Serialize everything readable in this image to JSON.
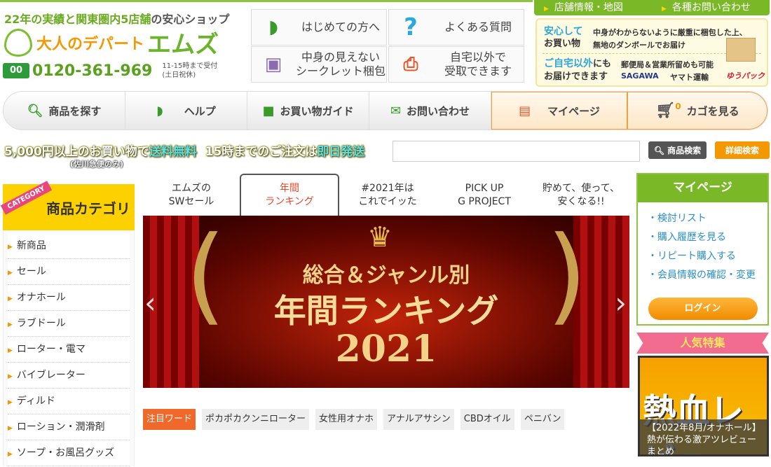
{
  "header": {
    "tagline_a": "22年の実績と関東圏内5店舗",
    "tagline_b": "の安心ショップ",
    "logo_text": "大人のデパート",
    "logo_brand": "エムズ",
    "freedial_icon": "free-dial-icon",
    "phone": "0120-361-969",
    "hours_1": "11-15時まで受付",
    "hours_2": "(土日祝休)"
  },
  "features": [
    {
      "label": "はじめての方へ",
      "icon": "beginner-mark-icon"
    },
    {
      "label": "よくある質問",
      "icon": "question-icon"
    },
    {
      "label": "中身の見えない\nシークレット梱包",
      "icon": "box-icon"
    },
    {
      "label": "自宅以外で\n受取できます",
      "icon": "receive-icon"
    }
  ],
  "topnav": [
    "店舗情報・地図",
    "各種お問い合わせ"
  ],
  "infobox": {
    "a_title1": "安心して",
    "a_title2": "お買い物",
    "a_text1": "中身がわからないように厳重に梱包した上、",
    "a_text2": "無地のダンボールでお届け",
    "b_title1": "ご自宅以外",
    "b_title1b": "にも",
    "b_title2": "お届けできます",
    "b_text": "郵便局＆営業所留めも可能",
    "carriers": [
      "SAGAWA",
      "ヤマト運輸",
      "ゆうパック"
    ]
  },
  "mainnav": [
    {
      "label": "商品を探す",
      "icon": "search-icon"
    },
    {
      "label": "ヘルプ",
      "icon": "beginner-mark-icon"
    },
    {
      "label": "お買い物ガイド",
      "icon": "shopping-bag-icon"
    },
    {
      "label": "お問い合わせ",
      "icon": "mail-icon"
    },
    {
      "label": "マイページ",
      "icon": "profile-card-icon"
    },
    {
      "label": "カゴを見る",
      "icon": "cart-icon",
      "count": "0"
    }
  ],
  "promo": {
    "p1": "5,000円以上のお買い物で",
    "p2": "送料無料",
    "p3": "15時までのご注文は",
    "p4": "即日発送",
    "note": "(佐川急便のみ)"
  },
  "search": {
    "value": "",
    "button": "商品検索",
    "advanced": "詳細検索"
  },
  "sidebar": {
    "ribbon": "CATEGORY",
    "title": "商品カテゴリ",
    "items": [
      "新商品",
      "セール",
      "オナホール",
      "ラブドール",
      "ローター・電マ",
      "バイブレーター",
      "ディルド",
      "ローション・潤滑剤",
      "ソープ・お風呂グッズ"
    ]
  },
  "tabs": [
    {
      "label": "エムズの\nSWセール"
    },
    {
      "label": "年間\nランキング",
      "active": true
    },
    {
      "label": "#2021年は\nこれでイッた"
    },
    {
      "label": "PICK UP\nG PROJECT"
    },
    {
      "label": "貯めて、使って、\n安くなる!!"
    }
  ],
  "banner": {
    "line1": "総合＆ジャンル別",
    "line2": "年間ランキング",
    "line3": "2021"
  },
  "tags": {
    "heading": "注目ワード",
    "items": [
      "ポカポカクンニローター",
      "女性用オナホ",
      "アナルアサシン",
      "CBDオイル",
      "ペニバン"
    ]
  },
  "mypage": {
    "title": "マイページ",
    "links": [
      "検討リスト",
      "購入履歴を見る",
      "リピート購入する",
      "会員情報の確認・変更"
    ],
    "login": "ログイン"
  },
  "ninki": {
    "title": "人気特集",
    "image_text": "熱血レビュー",
    "caption": "【2022年8月/オナホール】熱が伝わる激アツレビューまとめ"
  },
  "colors": {
    "brand_green": "#7ab828",
    "accent_orange": "#f39800",
    "tag_orange": "#f0682a"
  }
}
